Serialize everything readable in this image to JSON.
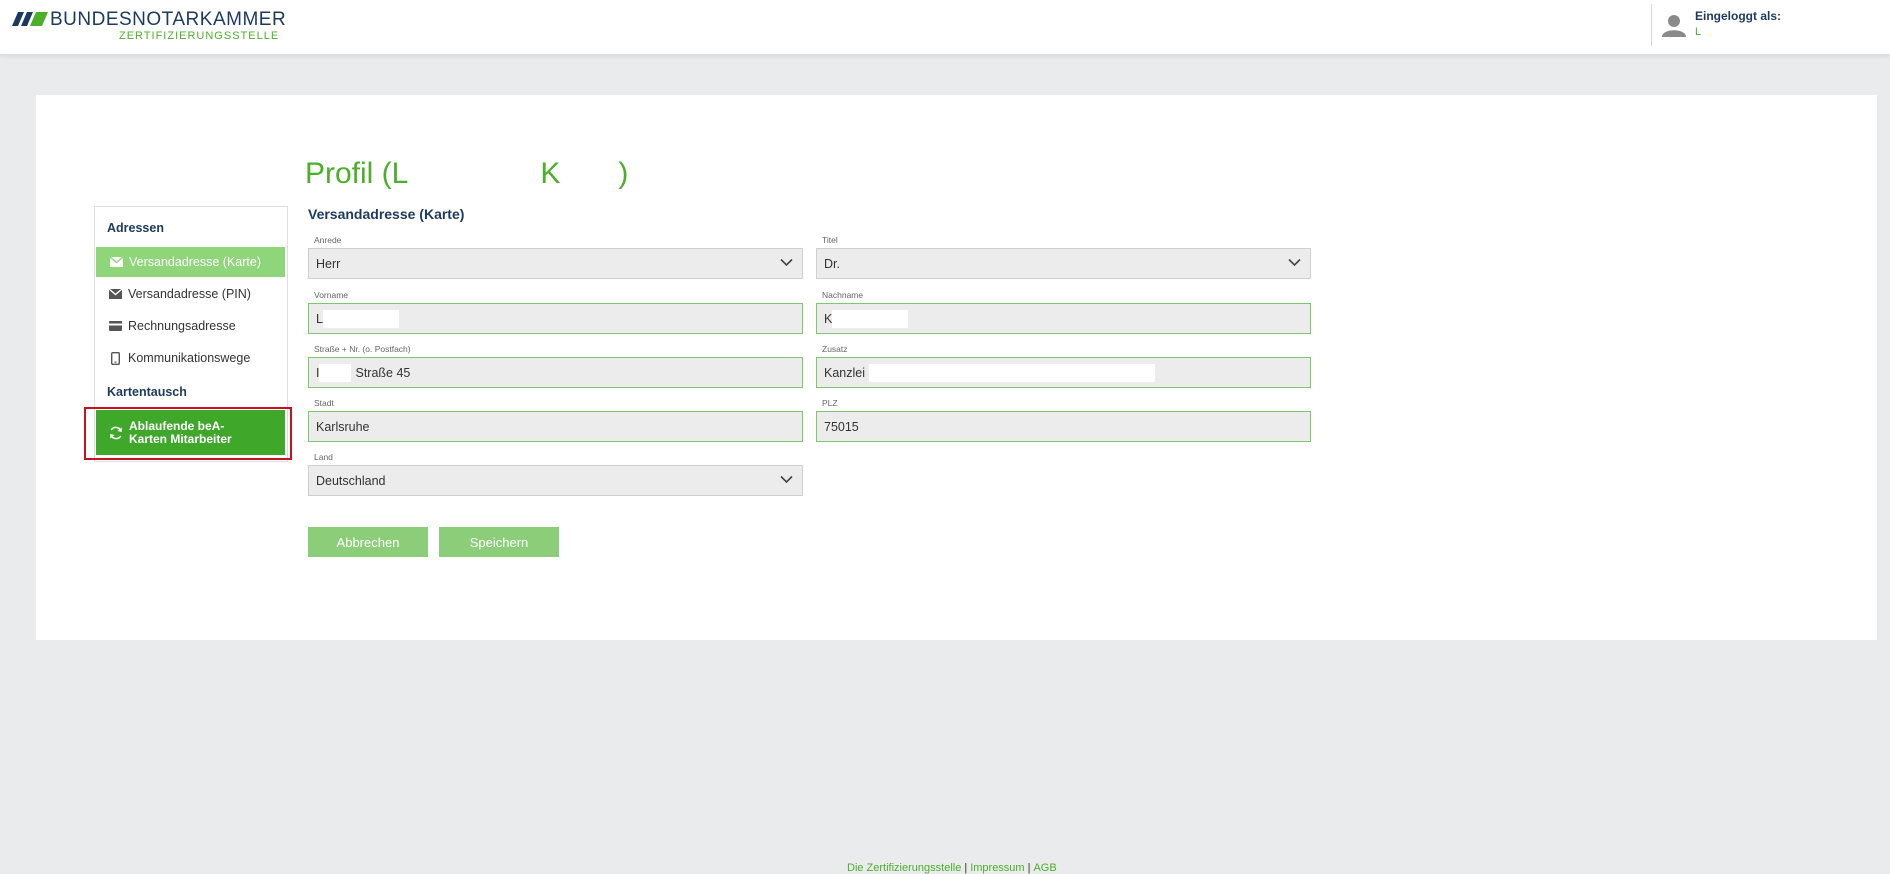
{
  "header": {
    "logo_title": "BUNDESNOTARKAMMER",
    "logo_subtitle": "ZERTIFIZIERUNGSSTELLE",
    "user_label": "Eingeloggt als:",
    "user_name": "L",
    "user_icon": "user-icon"
  },
  "page": {
    "title_start": "Profil (L",
    "title_mid": "K",
    "title_end": ")"
  },
  "sidebar": {
    "heading_addresses": "Adressen",
    "items": [
      {
        "label": "Versandadresse (Karte)",
        "icon": "envelope-icon",
        "active": true
      },
      {
        "label": "Versandadresse (PIN)",
        "icon": "envelope-icon",
        "active": false
      },
      {
        "label": "Rechnungsadresse",
        "icon": "credit-card-icon",
        "active": false
      },
      {
        "label": "Kommunikationswege",
        "icon": "phone-icon",
        "active": false
      }
    ],
    "heading_card_exchange": "Kartentausch",
    "cta": {
      "line1": "Ablaufende beA-",
      "line2": "Karten Mitarbeiter",
      "icon": "refresh-icon"
    }
  },
  "form": {
    "section_title": "Versandadresse (Karte)",
    "fields": {
      "anrede": {
        "label": "Anrede",
        "value": "Herr"
      },
      "titel": {
        "label": "Titel",
        "value": "Dr."
      },
      "vorname": {
        "label": "Vorname",
        "value": "L"
      },
      "nachname": {
        "label": "Nachname",
        "value": "K"
      },
      "strasse": {
        "label": "Straße + Nr. (o. Postfach)",
        "value_start": "I",
        "value_end": "Straße 45"
      },
      "zusatz": {
        "label": "Zusatz",
        "value": "Kanzlei"
      },
      "stadt": {
        "label": "Stadt",
        "value": "Karlsruhe"
      },
      "plz": {
        "label": "PLZ",
        "value": "75015"
      },
      "land": {
        "label": "Land",
        "value": "Deutschland"
      }
    },
    "cancel_label": "Abbrechen",
    "save_label": "Speichern"
  },
  "footer": {
    "link1": "Die Zertifizierungsstelle",
    "link2": "Impressum",
    "link3": "AGB",
    "separator": "|"
  },
  "colors": {
    "brand_green": "#4caf2a",
    "brand_navy": "#1c3a5e",
    "active_item": "#8fd57a",
    "cta_green": "#3fa82b",
    "highlight_red": "#c6121f"
  }
}
